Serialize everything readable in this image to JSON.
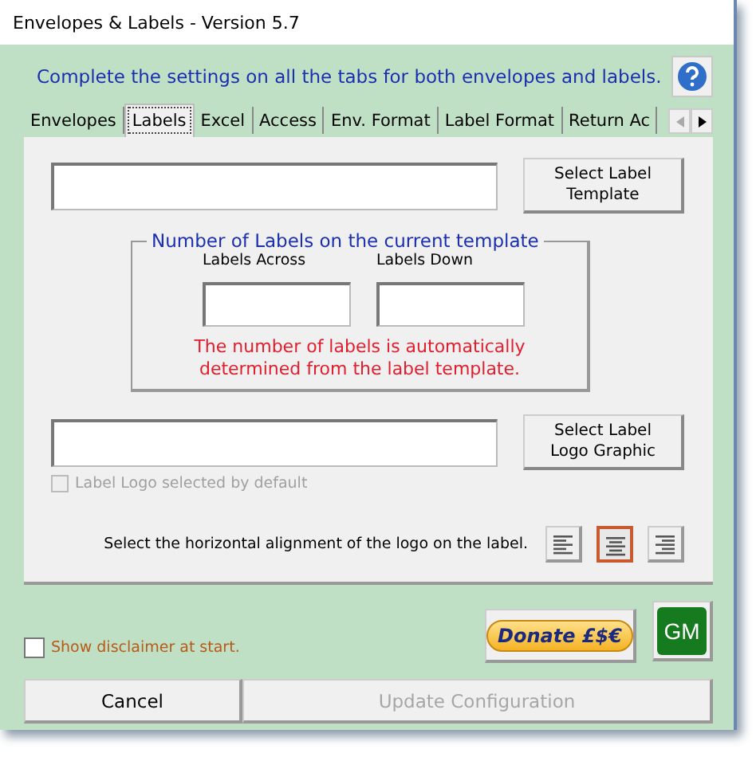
{
  "window": {
    "title": "Envelopes & Labels - Version 5.7"
  },
  "instructions": "Complete the settings on all the tabs for both envelopes and labels.",
  "tabs": [
    {
      "label": "Envelopes",
      "selected": false
    },
    {
      "label": "Labels",
      "selected": true
    },
    {
      "label": "Excel",
      "selected": false
    },
    {
      "label": "Access",
      "selected": false
    },
    {
      "label": "Env. Format",
      "selected": false
    },
    {
      "label": "Label Format",
      "selected": false
    },
    {
      "label": "Return Ac",
      "selected": false
    }
  ],
  "select_template_button": {
    "label": "Select Label Template"
  },
  "group": {
    "title": "Number of Labels on the current template",
    "across_label": "Labels Across",
    "down_label": "Labels Down",
    "note": "The number of labels is automatically determined from the label template."
  },
  "select_logo_button": {
    "label": "Select Label Logo Graphic"
  },
  "logo_default": {
    "label": "Label Logo selected by default",
    "checked": false,
    "disabled": true
  },
  "alignment": {
    "prompt": "Select the horizontal alignment of the logo on the label.",
    "options": [
      {
        "kind": "left",
        "selected": false
      },
      {
        "kind": "center",
        "selected": true
      },
      {
        "kind": "right",
        "selected": false
      }
    ]
  },
  "disclaimer": {
    "label": "Show disclaimer at start.",
    "checked": false
  },
  "donate_button": {
    "label": "Donate £$€"
  },
  "gm_button": {
    "label": "GM"
  },
  "cancel_button": {
    "label": "Cancel"
  },
  "update_button": {
    "label": "Update Configuration",
    "disabled": true
  }
}
